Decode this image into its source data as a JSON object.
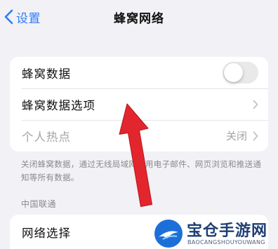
{
  "nav": {
    "back_label": "设置",
    "title": "蜂窝网络"
  },
  "cellular_group": {
    "items": [
      {
        "label": "蜂窝数据",
        "toggle_on": false
      },
      {
        "label": "蜂窝数据选项"
      },
      {
        "label": "个人热点",
        "value": "关闭"
      }
    ]
  },
  "footnote": "关闭蜂窝数据，通过无线局域网使用电子邮件、网页浏览和推送通知等所有数据。",
  "carrier_section": {
    "header": "中国联通",
    "items": [
      {
        "label": "网络选择"
      }
    ]
  },
  "watermark": {
    "title": "宝仓手游网",
    "subtitle": "BAOCANGSHOUYOUWANG"
  },
  "colors": {
    "accent": "#2f7cf6",
    "annotation_arrow": "#e3262d",
    "background": "#f1f1f6"
  },
  "icons": [
    "chevron-left-icon",
    "chevron-right-icon",
    "annotation-arrow",
    "watermark-logo"
  ]
}
